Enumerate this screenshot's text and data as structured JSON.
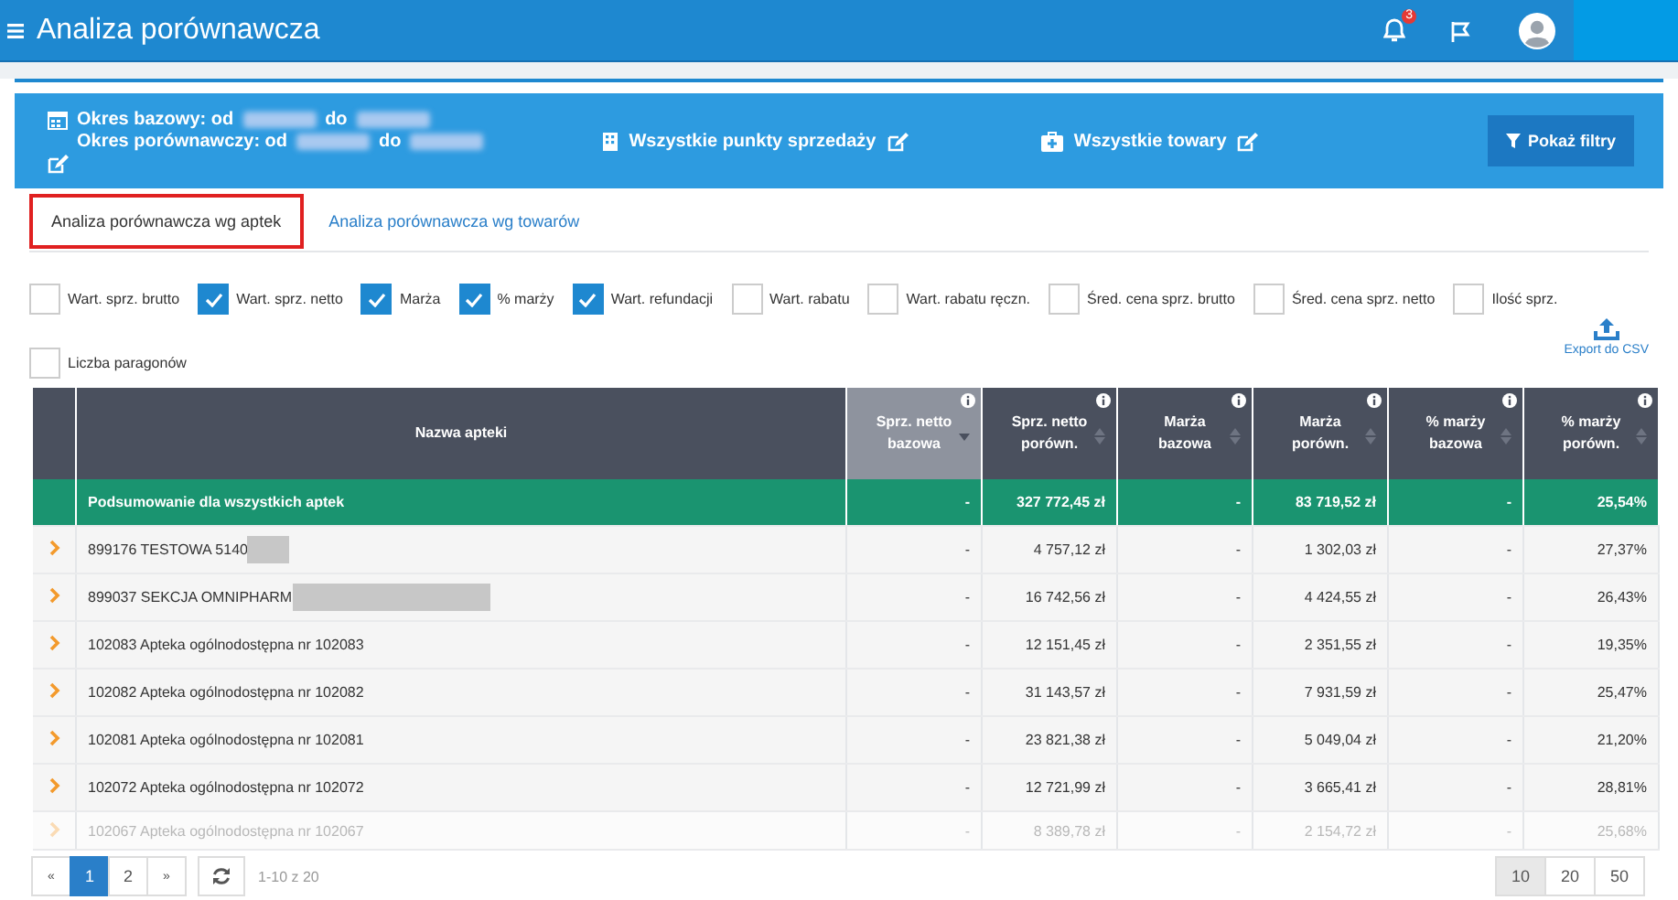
{
  "topbar": {
    "title": "Analiza porównawcza",
    "notifications": "3"
  },
  "filters": {
    "base_period": {
      "label": "Okres bazowy: od",
      "to": "do"
    },
    "compare_period": {
      "label": "Okres porównawczy: od",
      "to": "do"
    },
    "points": "Wszystkie punkty sprzedaży",
    "products": "Wszystkie towary",
    "button": "Pokaż filtry"
  },
  "tabs": [
    {
      "label": "Analiza porównawcza wg aptek",
      "selected": true
    },
    {
      "label": "Analiza porównawcza wg towarów",
      "selected": false
    }
  ],
  "options": [
    {
      "label": "Wart. sprz. brutto",
      "checked": false
    },
    {
      "label": "Wart. sprz. netto",
      "checked": true
    },
    {
      "label": "Marża",
      "checked": true
    },
    {
      "label": "% marży",
      "checked": true
    },
    {
      "label": "Wart. refundacji",
      "checked": true
    },
    {
      "label": "Wart. rabatu",
      "checked": false
    },
    {
      "label": "Wart. rabatu ręczn.",
      "checked": false
    },
    {
      "label": "Śred. cena sprz. brutto",
      "checked": false
    },
    {
      "label": "Śred. cena sprz. netto",
      "checked": false
    },
    {
      "label": "Ilość sprz.",
      "checked": false
    },
    {
      "label": "Liczba paragonów",
      "checked": false
    }
  ],
  "export": "Export do CSV",
  "table": {
    "columns": [
      {
        "label": "Nazwa apteki",
        "sorted": false,
        "info": false
      },
      {
        "label": "Sprz. netto bazowa",
        "sorted": true,
        "info": true
      },
      {
        "label": "Sprz. netto porówn.",
        "sorted": false,
        "info": true
      },
      {
        "label": "Marża bazowa",
        "sorted": false,
        "info": true
      },
      {
        "label": "Marża porówn.",
        "sorted": false,
        "info": true
      },
      {
        "label": "% marży bazowa",
        "sorted": false,
        "info": true
      },
      {
        "label": "% marży porówn.",
        "sorted": false,
        "info": true
      }
    ],
    "summary": [
      "Podsumowanie dla wszystkich aptek",
      "-",
      "327 772,45 zł",
      "-",
      "83 719,52 zł",
      "-",
      "25,54%"
    ],
    "rows": [
      {
        "kind": "redactedshort",
        "cells": [
          "899176 TESTOWA 5140",
          "-",
          "4 757,12 zł",
          "-",
          "1 302,03 zł",
          "-",
          "27,37%"
        ]
      },
      {
        "kind": "redactedlong",
        "cells": [
          "899037 SEKCJA OMNIPHARM",
          "-",
          "16 742,56 zł",
          "-",
          "4 424,55 zł",
          "-",
          "26,43%"
        ]
      },
      {
        "cells": [
          "102083 Apteka ogólnodostępna nr 102083",
          "-",
          "12 151,45 zł",
          "-",
          "2 351,55 zł",
          "-",
          "19,35%"
        ]
      },
      {
        "cells": [
          "102082 Apteka ogólnodostępna nr 102082",
          "-",
          "31 143,57 zł",
          "-",
          "7 931,59 zł",
          "-",
          "25,47%"
        ]
      },
      {
        "cells": [
          "102081 Apteka ogólnodostępna nr 102081",
          "-",
          "23 821,38 zł",
          "-",
          "5 049,04 zł",
          "-",
          "21,20%"
        ]
      },
      {
        "cells": [
          "102072 Apteka ogólnodostępna nr 102072",
          "-",
          "12 721,99 zł",
          "-",
          "3 665,41 zł",
          "-",
          "28,81%"
        ]
      },
      {
        "cells": [
          "102067 Apteka ogólnodostępna nr 102067",
          "-",
          "8 389,78 zł",
          "-",
          "2 154,72 zł",
          "-",
          "25,68%"
        ]
      }
    ]
  },
  "pagination": {
    "prev": "«",
    "pages": [
      {
        "label": "1",
        "selected": true
      },
      {
        "label": "2",
        "selected": false
      }
    ],
    "next": "»",
    "range": "1-10 z 20",
    "sizes": [
      {
        "label": "10",
        "selected": true
      },
      {
        "label": "20",
        "selected": false
      },
      {
        "label": "50",
        "selected": false
      }
    ]
  }
}
